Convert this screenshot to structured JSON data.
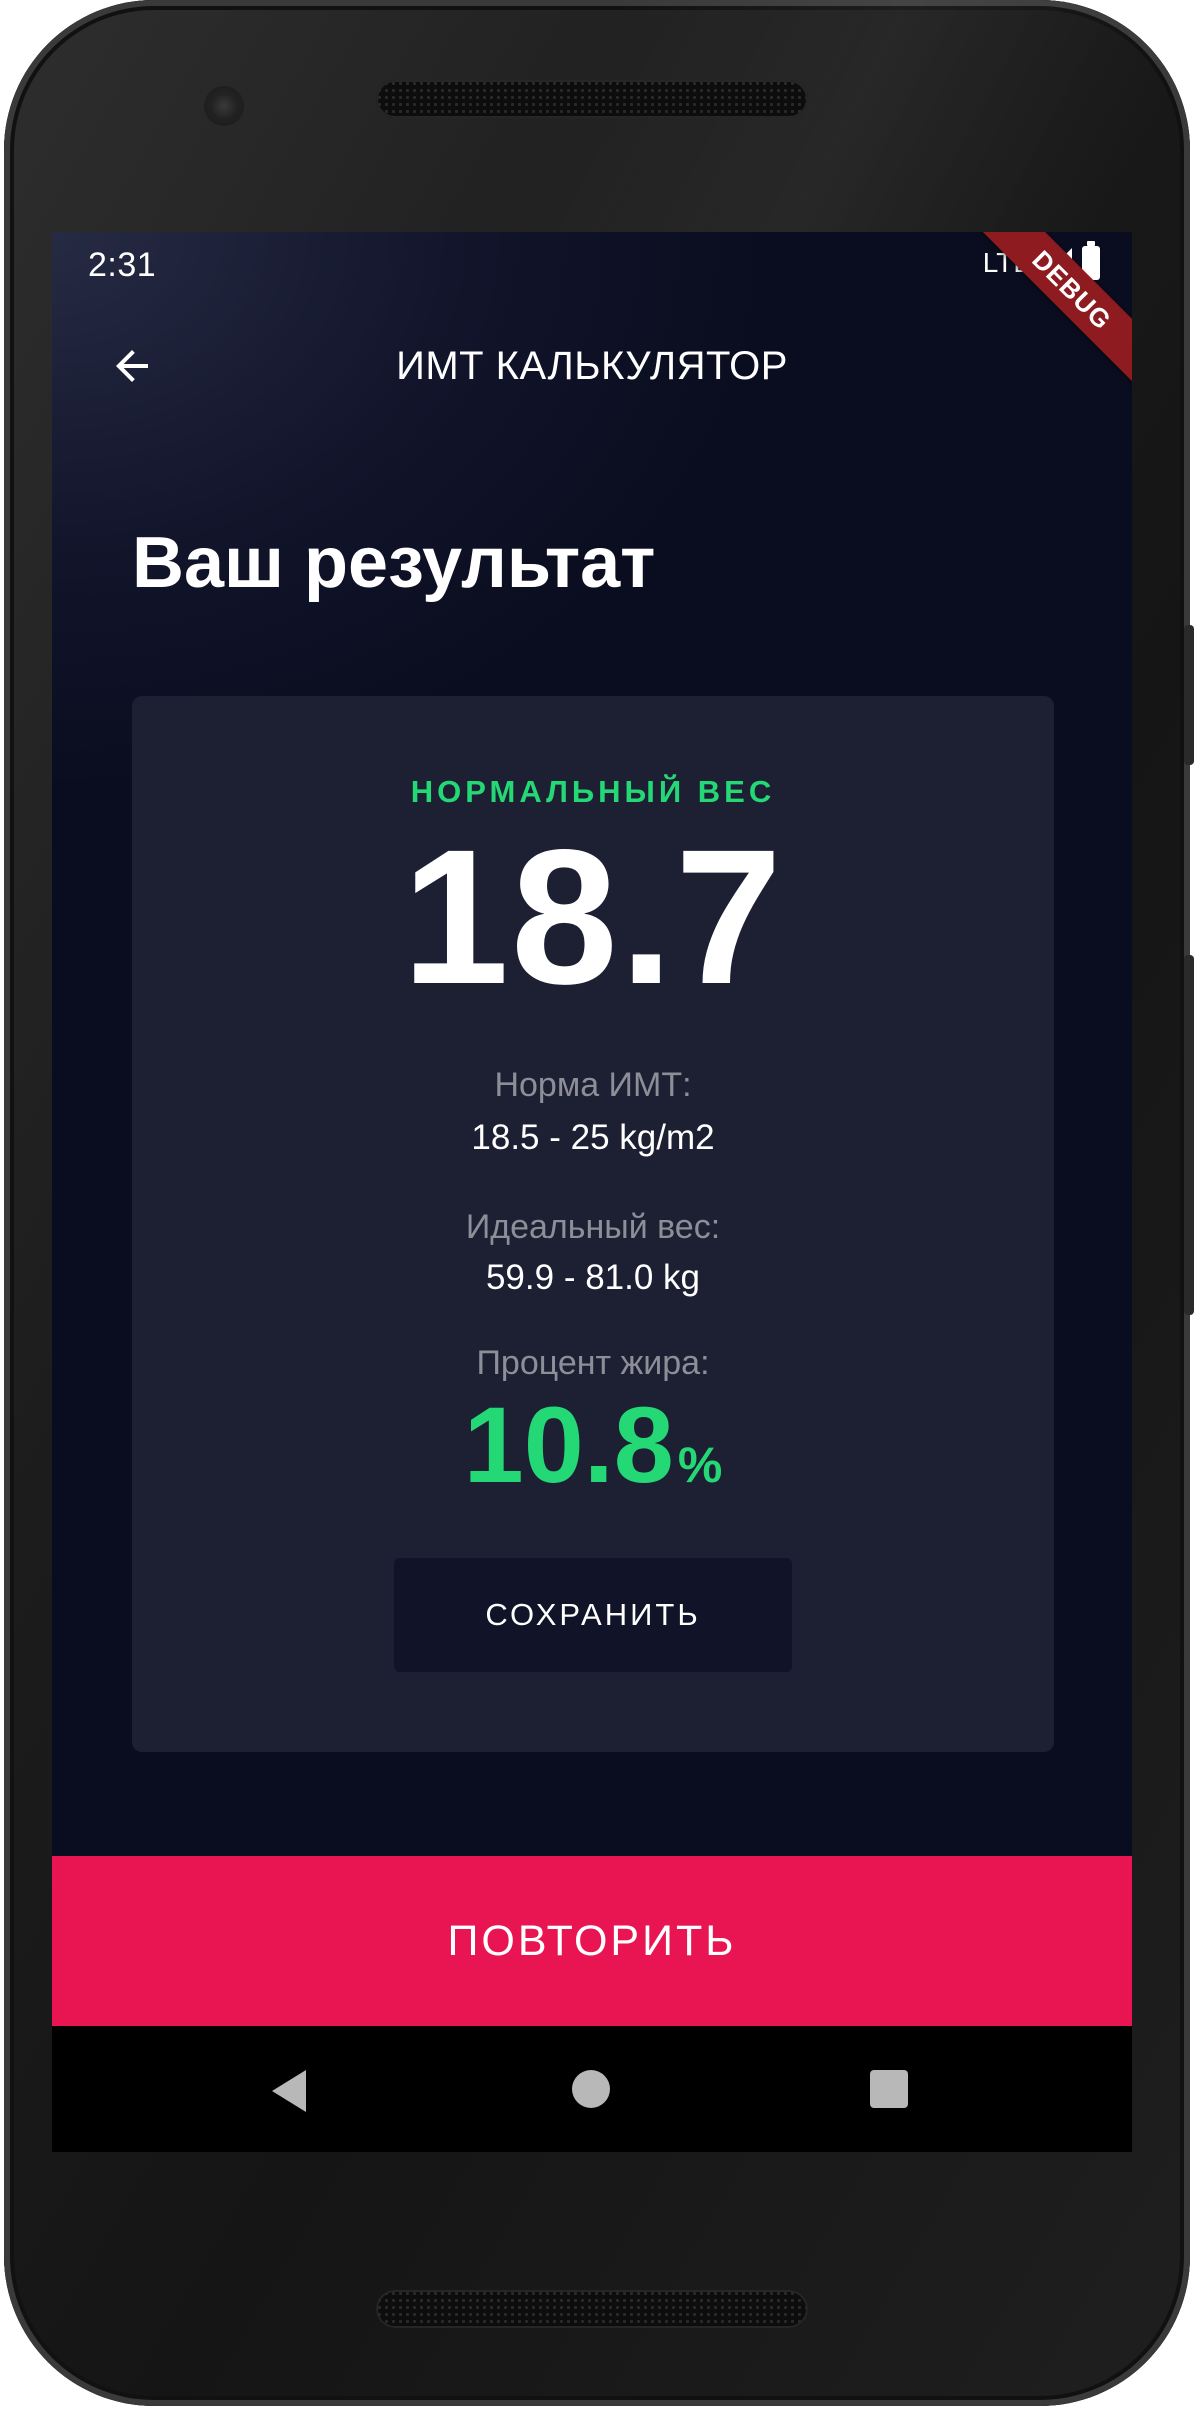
{
  "status_bar": {
    "time": "2:31",
    "network": "LTE",
    "debug_banner": "DEBUG"
  },
  "app_bar": {
    "title": "ИМТ КАЛЬКУЛЯТОР",
    "back_icon": "arrow-left-icon"
  },
  "page": {
    "heading": "Ваш результат"
  },
  "result": {
    "status": "НОРМАЛЬНЫЙ ВЕС",
    "bmi": "18.7",
    "norm_label": "Норма ИМТ:",
    "norm_value": "18.5 - 25 kg/m2",
    "ideal_label": "Идеальный вес:",
    "ideal_value": "59.9 - 81.0 kg",
    "fat_label": "Процент жира:",
    "fat_value": "10.8",
    "fat_unit": "%",
    "save_label": "СОХРАНИТЬ"
  },
  "footer": {
    "repeat_label": "ПОВТОРИТЬ"
  },
  "nav": {
    "back_icon": "nav-back-icon",
    "home_icon": "nav-home-icon",
    "recent_icon": "nav-recents-icon"
  },
  "colors": {
    "background": "#0a0d1f",
    "card": "#1d1f33",
    "accent_green": "#24d876",
    "accent_pink": "#e91552",
    "button_dark": "#111328"
  }
}
